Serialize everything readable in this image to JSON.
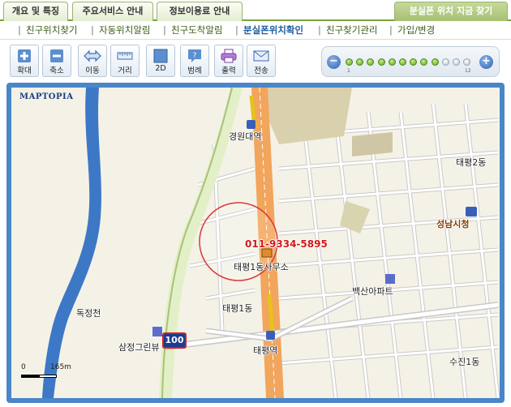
{
  "tabs": [
    {
      "label": "개요 및 특징"
    },
    {
      "label": "주요서비스 안내"
    },
    {
      "label": "정보이용료 안내"
    }
  ],
  "right_tab": {
    "label": "분실폰 위치 지금 찾기"
  },
  "submenu": {
    "items": [
      {
        "label": "친구위치찾기"
      },
      {
        "label": "자동위치알림"
      },
      {
        "label": "친구도착알림"
      },
      {
        "label": "분실폰위치확인",
        "active": true
      },
      {
        "label": "친구찾기관리"
      },
      {
        "label": "가입/변경"
      }
    ],
    "separator": "|"
  },
  "toolbar": {
    "buttons": [
      {
        "label": "확대",
        "icon": "zoom-in-icon"
      },
      {
        "label": "축소",
        "icon": "zoom-out-icon"
      },
      {
        "label": "이동",
        "icon": "move-icon"
      },
      {
        "label": "거리",
        "icon": "ruler-icon"
      },
      {
        "label": "2D",
        "icon": "2d-icon"
      },
      {
        "label": "범례",
        "icon": "legend-icon"
      },
      {
        "label": "출력",
        "icon": "print-icon"
      },
      {
        "label": "전송",
        "icon": "send-icon"
      }
    ]
  },
  "zoom": {
    "minus": "−",
    "plus": "+",
    "levels": 12,
    "current_level": 9,
    "min_label": "1",
    "max_label": "12"
  },
  "map": {
    "logo": "MAPTOPIA",
    "phone_number": "011-9334-5895",
    "labels": {
      "gyeongwon_station": "경원대역",
      "taepyeong2": "태평2동",
      "seongnam_cityhall": "성남시청",
      "taepyeong1_office": "태평1동사무소",
      "baeksan_apt": "백산아파트",
      "dokjeongcheon": "독정천",
      "taepyeong1": "태평1동",
      "samjeong_greenview": "삼정그린뷰",
      "taepyeong_station": "태평역",
      "sujin1": "수진1동"
    },
    "highway_number": "100",
    "scale": {
      "start": "0",
      "end": "165m"
    }
  },
  "colors": {
    "accent_green": "#7aa23c",
    "frame_blue": "#4a86c8",
    "phone_red": "#d21919",
    "river_blue": "#3d78c6",
    "main_road": "#f2a55c"
  }
}
